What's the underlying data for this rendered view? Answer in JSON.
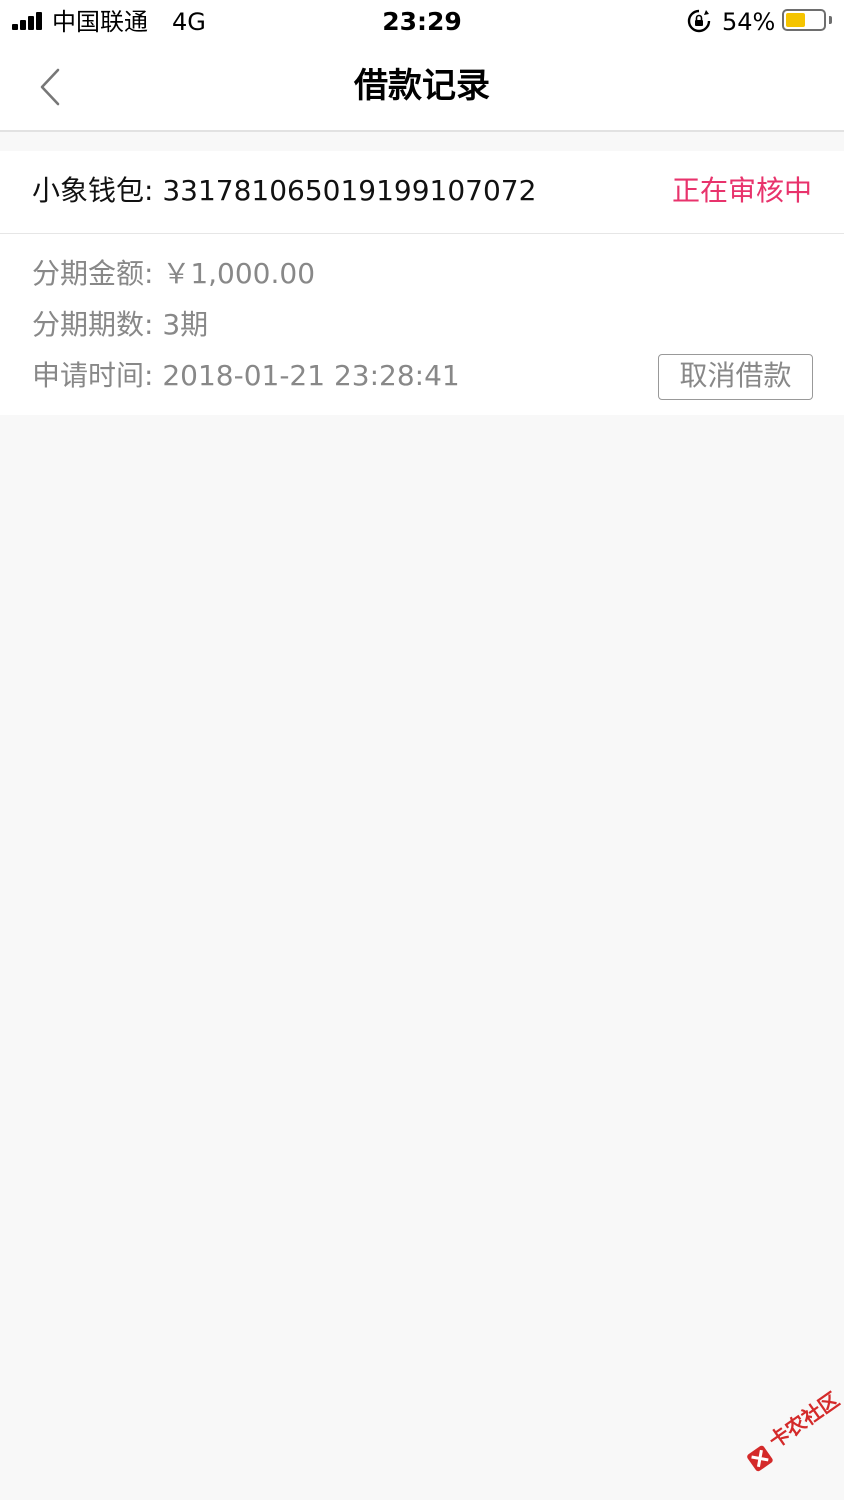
{
  "status_bar": {
    "carrier": "中国联通",
    "network": "4G",
    "time": "23:29",
    "battery_percent": "54%",
    "battery_level": 0.54,
    "icons": [
      "signal-icon",
      "rotation-lock-icon",
      "battery-icon"
    ]
  },
  "nav": {
    "title": "借款记录",
    "back_icon": "chevron-left-icon"
  },
  "record": {
    "wallet_label": "小象钱包: 3317810650191991070​72",
    "status": "正在审核中",
    "amount": "分期金额: ￥1,000.00",
    "periods": "分期期数: 3期",
    "apply_time": "申请时间: 2018-01-21 23:28:41",
    "cancel_button": "取消借款"
  },
  "colors": {
    "accent": "#e8336c",
    "background": "#f8f8f8",
    "muted_text": "#888888"
  },
  "watermark": {
    "text": "卡农社区"
  }
}
